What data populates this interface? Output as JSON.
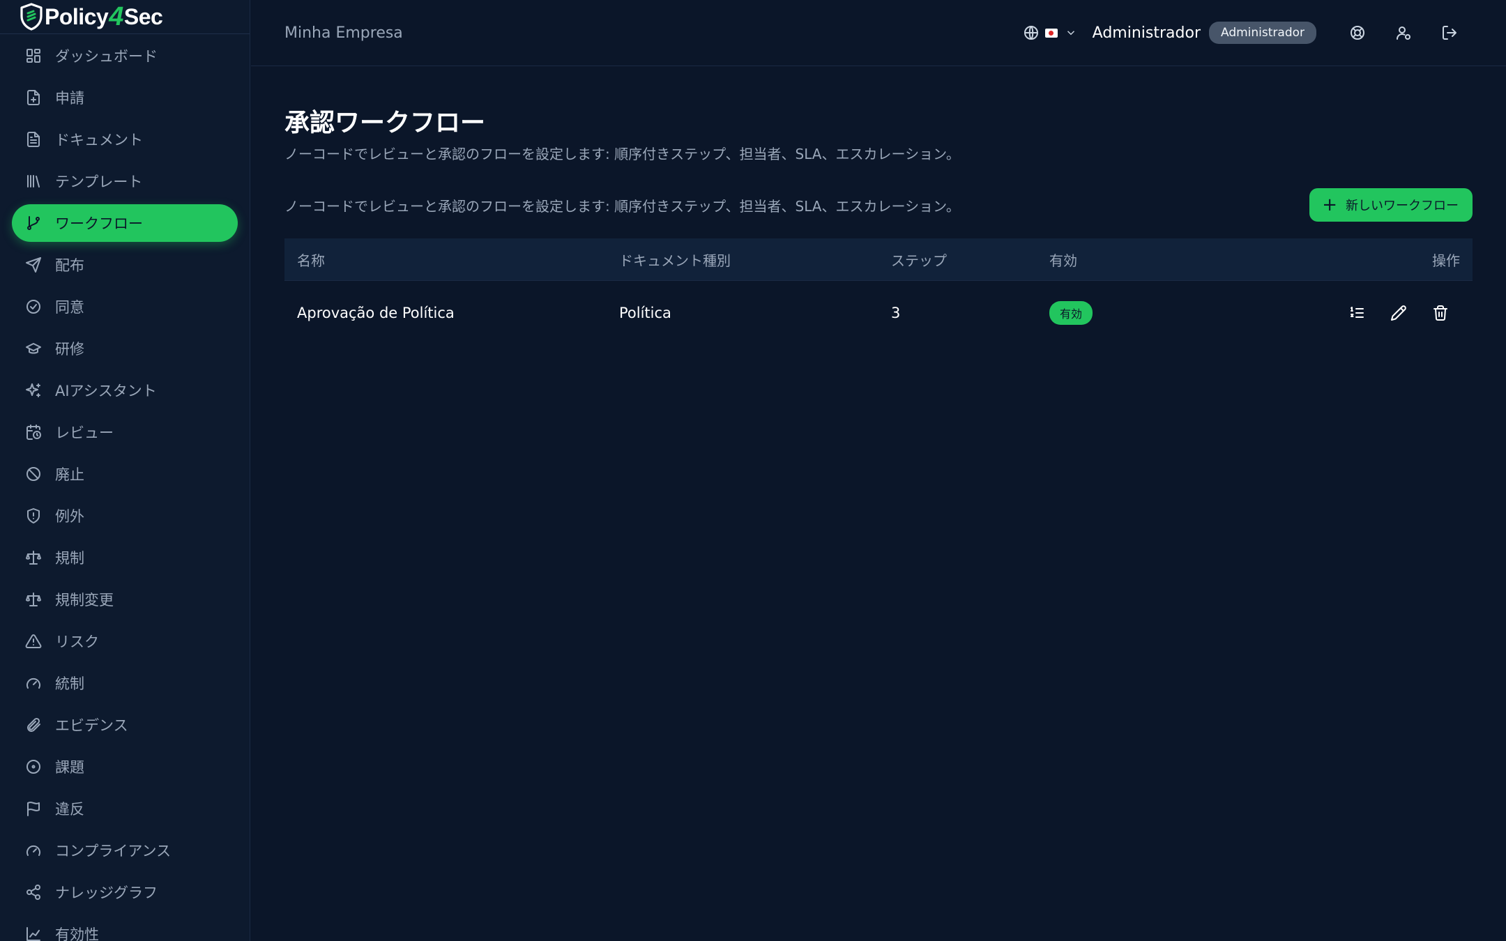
{
  "app": {
    "logo_text_left": "Policy",
    "logo_text_num": "4",
    "logo_text_right": "Sec"
  },
  "colors": {
    "accent": "#22c55e",
    "background": "#0b1629",
    "sidebar": "#0d1a2e",
    "table_header": "#11223a",
    "role_badge": "#475569"
  },
  "sidebar": {
    "items": [
      {
        "label": "ダッシュボード",
        "icon": "dashboard-icon"
      },
      {
        "label": "申請",
        "icon": "file-request-icon"
      },
      {
        "label": "ドキュメント",
        "icon": "document-icon"
      },
      {
        "label": "テンプレート",
        "icon": "library-icon"
      },
      {
        "label": "ワークフロー",
        "icon": "git-branch-icon",
        "active": true
      },
      {
        "label": "配布",
        "icon": "send-icon"
      },
      {
        "label": "同意",
        "icon": "check-circle-icon"
      },
      {
        "label": "研修",
        "icon": "graduation-cap-icon"
      },
      {
        "label": "AIアシスタント",
        "icon": "sparkles-icon"
      },
      {
        "label": "レビュー",
        "icon": "calendar-clock-icon"
      },
      {
        "label": "廃止",
        "icon": "ban-icon"
      },
      {
        "label": "例外",
        "icon": "shield-alert-icon"
      },
      {
        "label": "規制",
        "icon": "scale-icon"
      },
      {
        "label": "規制変更",
        "icon": "scale-icon"
      },
      {
        "label": "リスク",
        "icon": "alert-triangle-icon"
      },
      {
        "label": "統制",
        "icon": "gauge-icon"
      },
      {
        "label": "エビデンス",
        "icon": "paperclip-icon"
      },
      {
        "label": "課題",
        "icon": "circle-dot-icon"
      },
      {
        "label": "違反",
        "icon": "flag-icon"
      },
      {
        "label": "コンプライアンス",
        "icon": "gauge-icon"
      },
      {
        "label": "ナレッジグラフ",
        "icon": "share-icon"
      },
      {
        "label": "有効性",
        "icon": "chart-icon"
      }
    ]
  },
  "header": {
    "company": "Minha Empresa",
    "user_name": "Administrador",
    "role": "Administrador",
    "icons": [
      "globe-icon",
      "chevron-down-icon",
      "help-buoy-icon",
      "user-settings-icon",
      "logout-icon"
    ]
  },
  "page": {
    "title": "承認ワークフロー",
    "subtitle": "ノーコードでレビューと承認のフローを設定します: 順序付きステップ、担当者、SLA、エスカレーション。",
    "toolbar_desc": "ノーコードでレビューと承認のフローを設定します: 順序付きステップ、担当者、SLA、エスカレーション。",
    "new_button": "新しいワークフロー"
  },
  "table": {
    "headers": {
      "name": "名称",
      "doc_type": "ドキュメント種別",
      "steps": "ステップ",
      "active": "有効",
      "actions": "操作"
    },
    "rows": [
      {
        "name": "Aprovação de Política",
        "doc_type": "Política",
        "steps": "3",
        "status": "有効"
      }
    ]
  }
}
